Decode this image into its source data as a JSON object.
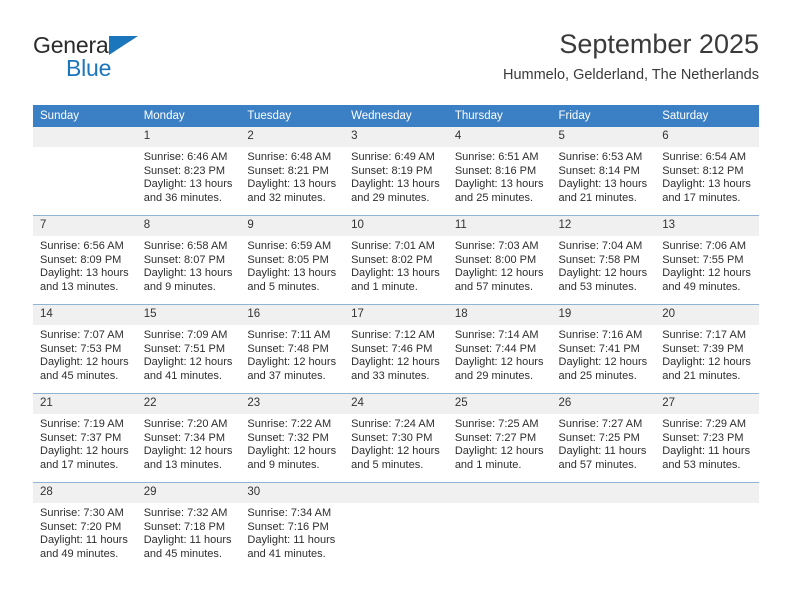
{
  "brand": {
    "word1": "General",
    "word2": "Blue",
    "accent_color": "#1b76bc"
  },
  "header": {
    "title": "September 2025",
    "subtitle": "Hummelo, Gelderland, The Netherlands"
  },
  "calendar": {
    "header_bg": "#3b7fc4",
    "daynum_bg": "#f0f0f0",
    "weekday_headers": [
      "Sunday",
      "Monday",
      "Tuesday",
      "Wednesday",
      "Thursday",
      "Friday",
      "Saturday"
    ],
    "labels": {
      "sunrise": "Sunrise:",
      "sunset": "Sunset:",
      "daylight": "Daylight:"
    },
    "weeks": [
      [
        {
          "day": "",
          "sunrise": "",
          "sunset": "",
          "daylight": ""
        },
        {
          "day": "1",
          "sunrise": "Sunrise: 6:46 AM",
          "sunset": "Sunset: 8:23 PM",
          "daylight": "Daylight: 13 hours and 36 minutes."
        },
        {
          "day": "2",
          "sunrise": "Sunrise: 6:48 AM",
          "sunset": "Sunset: 8:21 PM",
          "daylight": "Daylight: 13 hours and 32 minutes."
        },
        {
          "day": "3",
          "sunrise": "Sunrise: 6:49 AM",
          "sunset": "Sunset: 8:19 PM",
          "daylight": "Daylight: 13 hours and 29 minutes."
        },
        {
          "day": "4",
          "sunrise": "Sunrise: 6:51 AM",
          "sunset": "Sunset: 8:16 PM",
          "daylight": "Daylight: 13 hours and 25 minutes."
        },
        {
          "day": "5",
          "sunrise": "Sunrise: 6:53 AM",
          "sunset": "Sunset: 8:14 PM",
          "daylight": "Daylight: 13 hours and 21 minutes."
        },
        {
          "day": "6",
          "sunrise": "Sunrise: 6:54 AM",
          "sunset": "Sunset: 8:12 PM",
          "daylight": "Daylight: 13 hours and 17 minutes."
        }
      ],
      [
        {
          "day": "7",
          "sunrise": "Sunrise: 6:56 AM",
          "sunset": "Sunset: 8:09 PM",
          "daylight": "Daylight: 13 hours and 13 minutes."
        },
        {
          "day": "8",
          "sunrise": "Sunrise: 6:58 AM",
          "sunset": "Sunset: 8:07 PM",
          "daylight": "Daylight: 13 hours and 9 minutes."
        },
        {
          "day": "9",
          "sunrise": "Sunrise: 6:59 AM",
          "sunset": "Sunset: 8:05 PM",
          "daylight": "Daylight: 13 hours and 5 minutes."
        },
        {
          "day": "10",
          "sunrise": "Sunrise: 7:01 AM",
          "sunset": "Sunset: 8:02 PM",
          "daylight": "Daylight: 13 hours and 1 minute."
        },
        {
          "day": "11",
          "sunrise": "Sunrise: 7:03 AM",
          "sunset": "Sunset: 8:00 PM",
          "daylight": "Daylight: 12 hours and 57 minutes."
        },
        {
          "day": "12",
          "sunrise": "Sunrise: 7:04 AM",
          "sunset": "Sunset: 7:58 PM",
          "daylight": "Daylight: 12 hours and 53 minutes."
        },
        {
          "day": "13",
          "sunrise": "Sunrise: 7:06 AM",
          "sunset": "Sunset: 7:55 PM",
          "daylight": "Daylight: 12 hours and 49 minutes."
        }
      ],
      [
        {
          "day": "14",
          "sunrise": "Sunrise: 7:07 AM",
          "sunset": "Sunset: 7:53 PM",
          "daylight": "Daylight: 12 hours and 45 minutes."
        },
        {
          "day": "15",
          "sunrise": "Sunrise: 7:09 AM",
          "sunset": "Sunset: 7:51 PM",
          "daylight": "Daylight: 12 hours and 41 minutes."
        },
        {
          "day": "16",
          "sunrise": "Sunrise: 7:11 AM",
          "sunset": "Sunset: 7:48 PM",
          "daylight": "Daylight: 12 hours and 37 minutes."
        },
        {
          "day": "17",
          "sunrise": "Sunrise: 7:12 AM",
          "sunset": "Sunset: 7:46 PM",
          "daylight": "Daylight: 12 hours and 33 minutes."
        },
        {
          "day": "18",
          "sunrise": "Sunrise: 7:14 AM",
          "sunset": "Sunset: 7:44 PM",
          "daylight": "Daylight: 12 hours and 29 minutes."
        },
        {
          "day": "19",
          "sunrise": "Sunrise: 7:16 AM",
          "sunset": "Sunset: 7:41 PM",
          "daylight": "Daylight: 12 hours and 25 minutes."
        },
        {
          "day": "20",
          "sunrise": "Sunrise: 7:17 AM",
          "sunset": "Sunset: 7:39 PM",
          "daylight": "Daylight: 12 hours and 21 minutes."
        }
      ],
      [
        {
          "day": "21",
          "sunrise": "Sunrise: 7:19 AM",
          "sunset": "Sunset: 7:37 PM",
          "daylight": "Daylight: 12 hours and 17 minutes."
        },
        {
          "day": "22",
          "sunrise": "Sunrise: 7:20 AM",
          "sunset": "Sunset: 7:34 PM",
          "daylight": "Daylight: 12 hours and 13 minutes."
        },
        {
          "day": "23",
          "sunrise": "Sunrise: 7:22 AM",
          "sunset": "Sunset: 7:32 PM",
          "daylight": "Daylight: 12 hours and 9 minutes."
        },
        {
          "day": "24",
          "sunrise": "Sunrise: 7:24 AM",
          "sunset": "Sunset: 7:30 PM",
          "daylight": "Daylight: 12 hours and 5 minutes."
        },
        {
          "day": "25",
          "sunrise": "Sunrise: 7:25 AM",
          "sunset": "Sunset: 7:27 PM",
          "daylight": "Daylight: 12 hours and 1 minute."
        },
        {
          "day": "26",
          "sunrise": "Sunrise: 7:27 AM",
          "sunset": "Sunset: 7:25 PM",
          "daylight": "Daylight: 11 hours and 57 minutes."
        },
        {
          "day": "27",
          "sunrise": "Sunrise: 7:29 AM",
          "sunset": "Sunset: 7:23 PM",
          "daylight": "Daylight: 11 hours and 53 minutes."
        }
      ],
      [
        {
          "day": "28",
          "sunrise": "Sunrise: 7:30 AM",
          "sunset": "Sunset: 7:20 PM",
          "daylight": "Daylight: 11 hours and 49 minutes."
        },
        {
          "day": "29",
          "sunrise": "Sunrise: 7:32 AM",
          "sunset": "Sunset: 7:18 PM",
          "daylight": "Daylight: 11 hours and 45 minutes."
        },
        {
          "day": "30",
          "sunrise": "Sunrise: 7:34 AM",
          "sunset": "Sunset: 7:16 PM",
          "daylight": "Daylight: 11 hours and 41 minutes."
        },
        {
          "day": "",
          "sunrise": "",
          "sunset": "",
          "daylight": ""
        },
        {
          "day": "",
          "sunrise": "",
          "sunset": "",
          "daylight": ""
        },
        {
          "day": "",
          "sunrise": "",
          "sunset": "",
          "daylight": ""
        },
        {
          "day": "",
          "sunrise": "",
          "sunset": "",
          "daylight": ""
        }
      ]
    ]
  }
}
